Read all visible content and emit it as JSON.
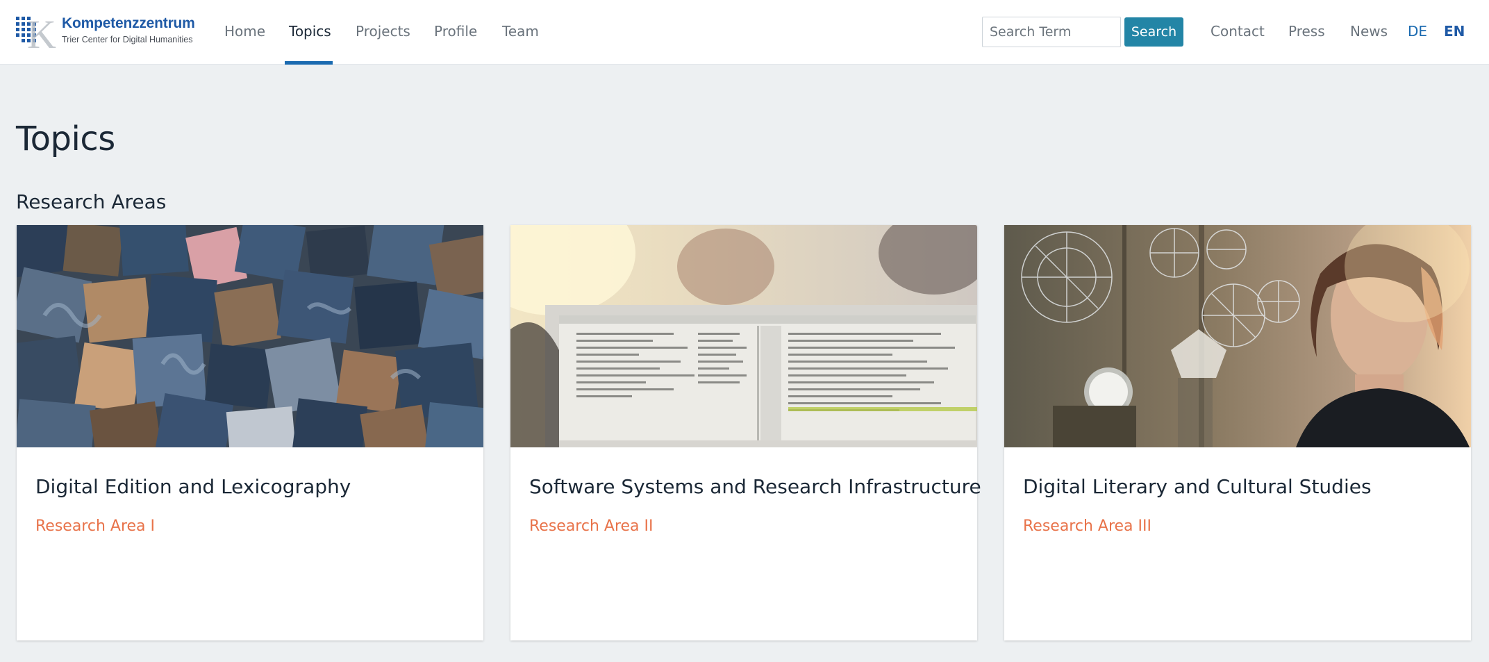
{
  "brand": {
    "title": "Kompetenzzentrum",
    "subtitle": "Trier Center for Digital Humanities",
    "mark_letter": "K",
    "primary_color": "#1f5aa6"
  },
  "nav": {
    "items": [
      {
        "label": "Home",
        "active": false
      },
      {
        "label": "Topics",
        "active": true
      },
      {
        "label": "Projects",
        "active": false
      },
      {
        "label": "Profile",
        "active": false
      },
      {
        "label": "Team",
        "active": false
      }
    ],
    "active_color": "#1a6ab0"
  },
  "search": {
    "placeholder": "Search Term",
    "value": "",
    "button_label": "Search",
    "button_color": "#2385a6"
  },
  "utility_nav": {
    "items": [
      "Contact",
      "Press",
      "News"
    ]
  },
  "languages": {
    "items": [
      "DE",
      "EN"
    ],
    "selected": "EN"
  },
  "page": {
    "title": "Topics",
    "section_title": "Research Areas"
  },
  "cards": [
    {
      "title": "Digital Edition and Lexicography",
      "subtitle": "Research Area I",
      "image_icon": "letterpress-type-photo"
    },
    {
      "title": "Software Systems and Research Infrastructure",
      "subtitle": "Research Area II",
      "image_icon": "code-screen-photo"
    },
    {
      "title": "Digital Literary and Cultural Studies",
      "subtitle": "Research Area III",
      "image_icon": "woman-with-diagrams-photo"
    }
  ],
  "accent_color": "#e8734a"
}
